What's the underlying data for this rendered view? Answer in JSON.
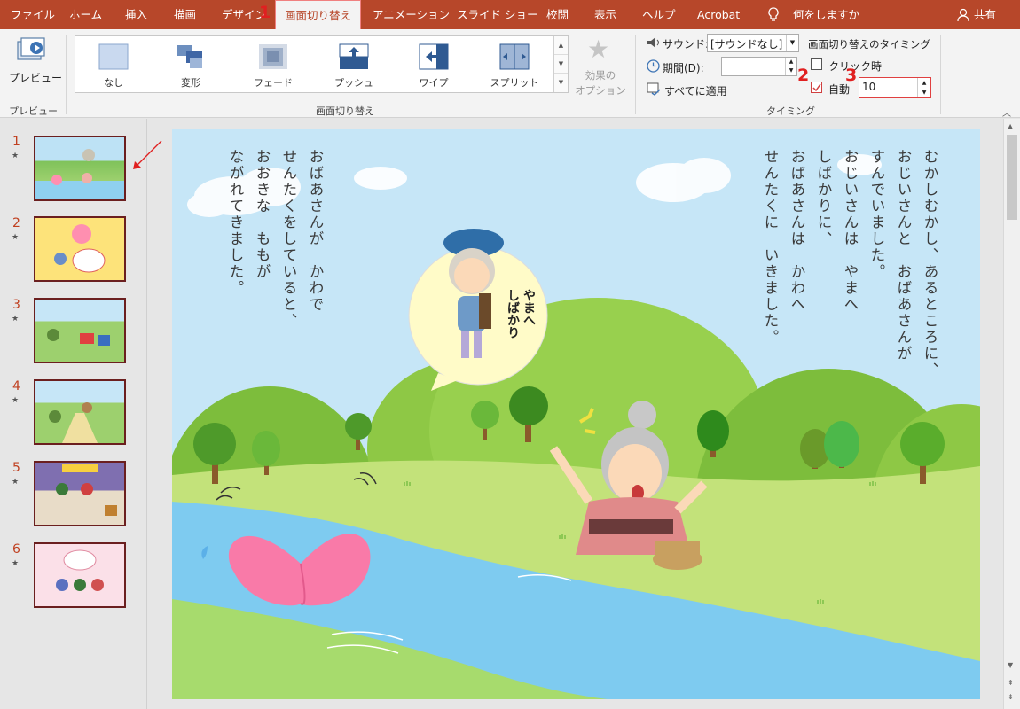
{
  "menu": {
    "tabs": [
      "ファイル",
      "ホーム",
      "挿入",
      "描画",
      "デザイン",
      "画面切り替え",
      "アニメーション",
      "スライド ショー",
      "校閲",
      "表示",
      "ヘルプ",
      "Acrobat"
    ],
    "tell_me": "何をしますか",
    "share": "共有"
  },
  "annotations": {
    "one": "1",
    "two": "2",
    "three": "3"
  },
  "ribbon": {
    "preview_label": "プレビュー",
    "preview_group": "プレビュー",
    "transitions": [
      "なし",
      "変形",
      "フェード",
      "プッシュ",
      "ワイプ",
      "スプリット"
    ],
    "effect_options_line1": "効果の",
    "effect_options_line2": "オプション",
    "transitions_group": "画面切り替え",
    "sound_label": "サウンド:",
    "sound_value": "[サウンドなし]",
    "duration_label": "期間(D):",
    "duration_value": "",
    "apply_all": "すべてに適用",
    "timing_title": "画面切り替えのタイミング",
    "on_click_label": "クリック時",
    "on_click_checked": false,
    "auto_label": "自動",
    "auto_checked": true,
    "auto_value": "10",
    "timing_group": "タイミング"
  },
  "slides": [
    {
      "num": "1",
      "selected": true
    },
    {
      "num": "2"
    },
    {
      "num": "3"
    },
    {
      "num": "4"
    },
    {
      "num": "5"
    },
    {
      "num": "6"
    }
  ],
  "star_glyph": "★",
  "slide_text": {
    "right_lines": [
      "むかしむかし、あるところに、",
      "おじいさんと　おばあさんが",
      "すんでいました。",
      "おじいさんは　やまへ",
      "しばかりに、",
      "おばあさんは　かわへ",
      "せんたくに　いきました。"
    ],
    "left_lines": [
      "おばあさんが　かわで",
      "せんたくをしていると、",
      "おおきな　ももが",
      "ながれてきました。"
    ],
    "bubble_line1": "やまへ",
    "bubble_line2": "しばかり"
  },
  "colors": {
    "brand": "#b7472a",
    "annotation": "#e02020"
  }
}
